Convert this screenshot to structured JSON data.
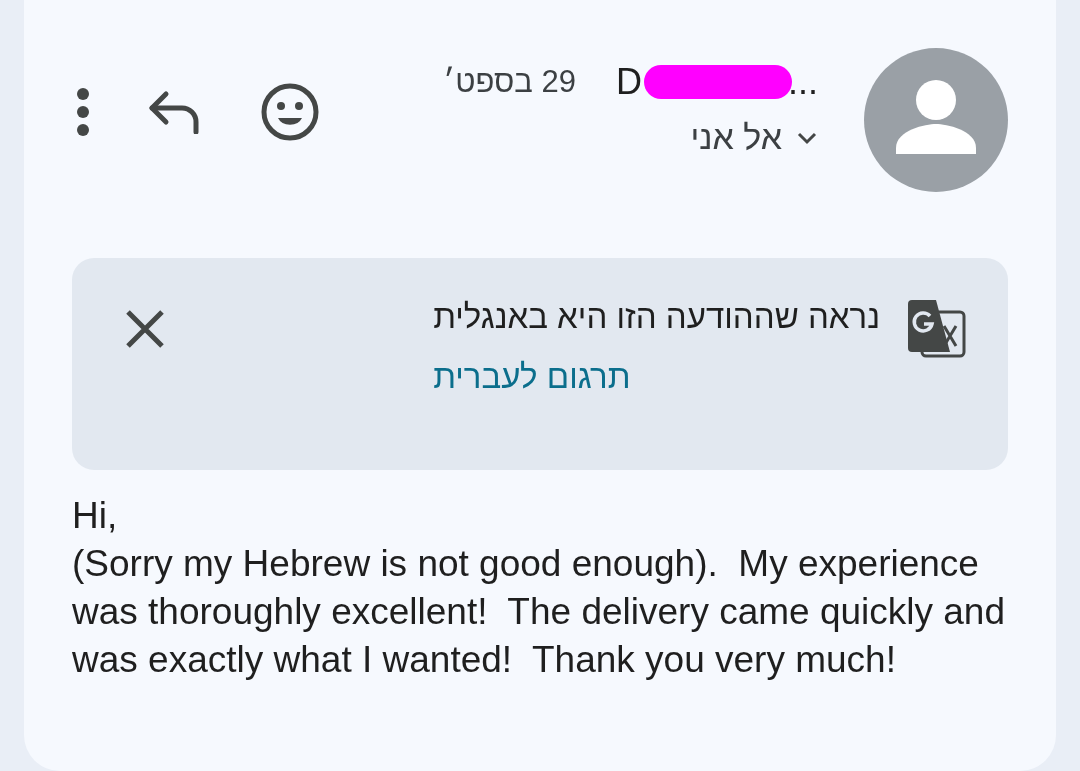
{
  "header": {
    "sender_name": "D",
    "sender_truncation": "...",
    "date": "29 בספט׳",
    "recipient": "אל אני",
    "recipient_expanded": false
  },
  "translate_banner": {
    "message": "נראה שההודעה הזו היא באנגלית",
    "action": "תרגום לעברית"
  },
  "body": [
    "Hi,",
    "(Sorry my Hebrew is not good enough).  My experience was thoroughly excellent!  The delivery came quickly and was exactly what I wanted!  Thank you very much!"
  ]
}
